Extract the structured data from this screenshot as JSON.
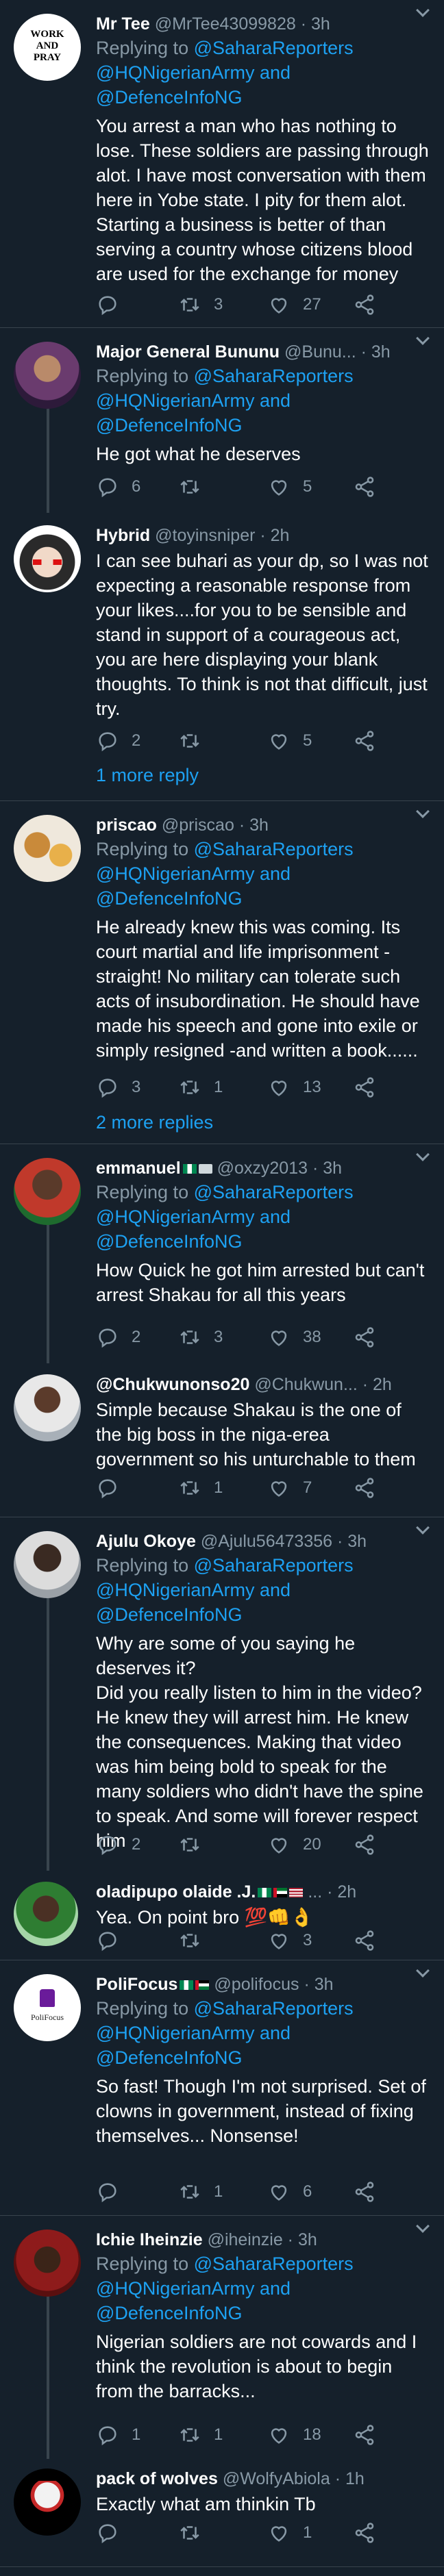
{
  "tweets": [
    {
      "name": "Mr Tee",
      "handle": "@MrTee43099828",
      "time": "· 3h",
      "replying_label": "Replying to",
      "mentions": [
        "@SaharaReporters",
        "@HQNigerianArmy and",
        "@DefenceInfoNG"
      ],
      "text": "You arrest a man who has nothing to lose. These soldiers are passing through alot. I have most conversation with them here in Yobe state. I pity for them alot. Starting a business is better of than serving a country whose citizens blood are used for the exchange for money",
      "replies": "",
      "retweets": "3",
      "likes": "27",
      "avatar_text": "WORK AND PRAY"
    },
    {
      "name": "Major General Bununu",
      "handle": "@Bunu...",
      "time": "· 3h",
      "replying_label": "Replying to",
      "mentions": [
        "@SaharaReporters",
        "@HQNigerianArmy and",
        "@DefenceInfoNG"
      ],
      "text": "He got what he deserves",
      "replies": "6",
      "retweets": "",
      "likes": "5"
    },
    {
      "name": "Hybrid",
      "handle": "@toyinsniper",
      "time": "· 2h",
      "text": "I can see buhari as your dp, so I was not expecting a reasonable response from your likes....for you to be sensible and stand in support of a courageous act, you are here displaying your blank thoughts. To think is not that difficult, just try.",
      "replies": "2",
      "retweets": "",
      "likes": "5",
      "show_more": "1 more reply"
    },
    {
      "name": "priscao",
      "handle": "@priscao",
      "time": "· 3h",
      "replying_label": "Replying to",
      "mentions": [
        "@SaharaReporters",
        "@HQNigerianArmy and",
        "@DefenceInfoNG"
      ],
      "text": "He already knew this was coming. Its court martial and life imprisonment - straight! No military can tolerate such acts of insubordination. He should have made his speech and gone into exile or simply resigned -and written a book......",
      "replies": "3",
      "retweets": "1",
      "likes": "13",
      "show_more": "2 more replies"
    },
    {
      "name": "emmanuel",
      "handle": "@oxzy2013",
      "time": "· 3h",
      "replying_label": "Replying to",
      "mentions": [
        "@SaharaReporters",
        "@HQNigerianArmy and",
        "@DefenceInfoNG"
      ],
      "text": "How Quick he got him arrested but can't arrest Shakau for all this years",
      "replies": "2",
      "retweets": "3",
      "likes": "38"
    },
    {
      "name": "@Chukwunonso20",
      "handle": "@Chukwun...",
      "time": "· 2h",
      "text": "Simple because Shakau is the one of the big boss in the niga-erea government so his unturchable to them",
      "replies": "",
      "retweets": "1",
      "likes": "7"
    },
    {
      "name": "Ajulu Okoye",
      "handle": "@Ajulu56473356",
      "time": "· 3h",
      "replying_label": "Replying to",
      "mentions": [
        "@SaharaReporters",
        "@HQNigerianArmy and",
        "@DefenceInfoNG"
      ],
      "text": "Why are some of you saying he deserves it?\nDid you really listen to him in the video? He knew they will arrest him. He knew the consequences. Making that video was him being bold to speak for the many soldiers who didn't have the spine to speak. And some will forever respect him",
      "replies": "2",
      "retweets": "",
      "likes": "20"
    },
    {
      "name": "oladipupo olaide .J.",
      "handle": "...",
      "time": "· 2h",
      "text": "Yea. On point bro 💯👊👌",
      "replies": "",
      "retweets": "",
      "likes": "3"
    },
    {
      "name": "PoliFocus",
      "handle": "@polifocus",
      "time": "· 3h",
      "replying_label": "Replying to",
      "mentions": [
        "@SaharaReporters",
        "@HQNigerianArmy and",
        "@DefenceInfoNG"
      ],
      "text": "So fast! Though I'm not surprised. Set of clowns in government, instead of fixing themselves... Nonsense!",
      "replies": "",
      "retweets": "1",
      "likes": "6",
      "avatar_text": "PoliFocus"
    },
    {
      "name": "Ichie Iheinzie",
      "handle": "@iheinzie",
      "time": "· 3h",
      "replying_label": "Replying to",
      "mentions": [
        "@SaharaReporters",
        "@HQNigerianArmy and",
        "@DefenceInfoNG"
      ],
      "text": "Nigerian soldiers are not cowards and I think the revolution is about to begin from the barracks...",
      "replies": "1",
      "retweets": "1",
      "likes": "18"
    },
    {
      "name": "pack of wolves",
      "handle": "@WolfyAbiola",
      "time": "· 1h",
      "text": "Exactly what am thinkin Tb",
      "replies": "",
      "retweets": "",
      "likes": "1"
    }
  ],
  "colors": {
    "background": "#15202b",
    "text": "#ffffff",
    "muted": "#8899a6",
    "link": "#1da1f2",
    "divider": "#38444d"
  },
  "icons": [
    "reply-icon",
    "retweet-icon",
    "like-icon",
    "share-icon",
    "caret-down-icon"
  ]
}
